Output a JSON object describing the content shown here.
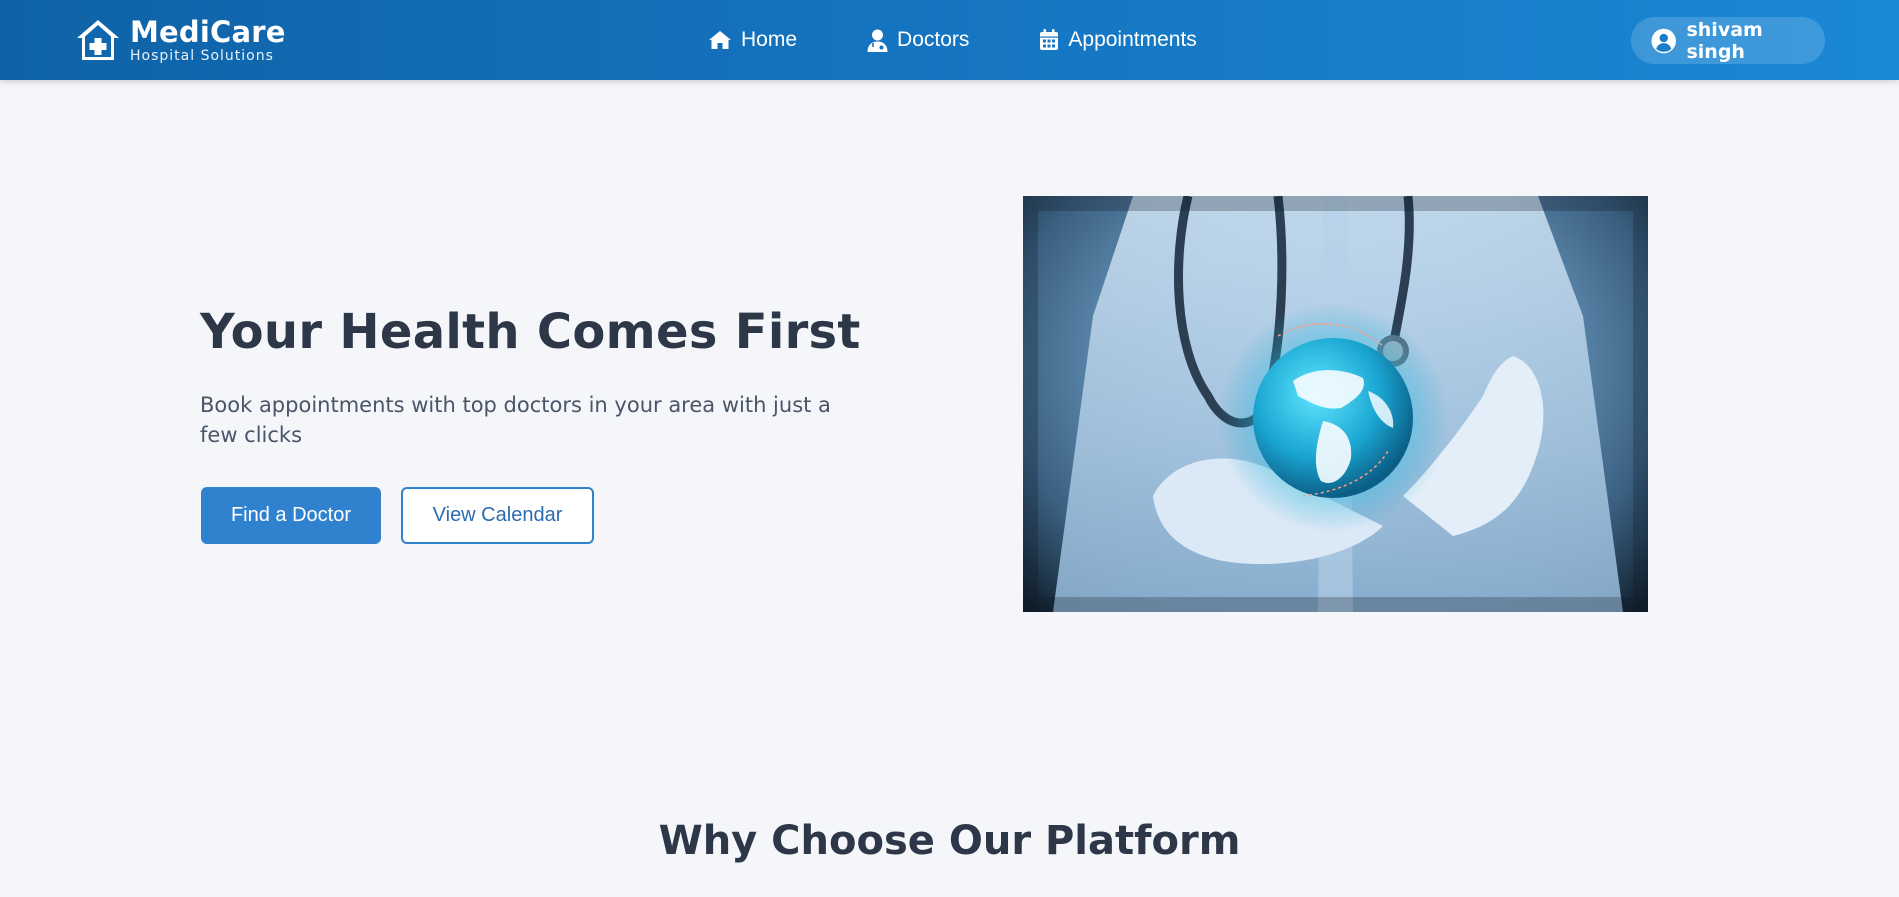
{
  "brand": {
    "name": "MediCare",
    "subtitle": "Hospital Solutions"
  },
  "nav": {
    "items": [
      {
        "label": "Home",
        "icon": "home-icon"
      },
      {
        "label": "Doctors",
        "icon": "doctor-icon"
      },
      {
        "label": "Appointments",
        "icon": "calendar-icon"
      }
    ]
  },
  "user": {
    "name": "shivam singh",
    "icon": "user-circle-icon"
  },
  "hero": {
    "title": "Your Health Comes First",
    "subtitle": "Book appointments with top doctors in your area with just a few clicks",
    "primary_button": "Find a Doctor",
    "secondary_button": "View Calendar",
    "image_subject": "doctor holding glowing globe"
  },
  "features": {
    "title": "Why Choose Our Platform"
  },
  "colors": {
    "navbar_start": "#0f62a6",
    "navbar_end": "#1a88d6",
    "primary": "#3182ce",
    "heading": "#2d3748",
    "background": "#f4f6f9"
  }
}
